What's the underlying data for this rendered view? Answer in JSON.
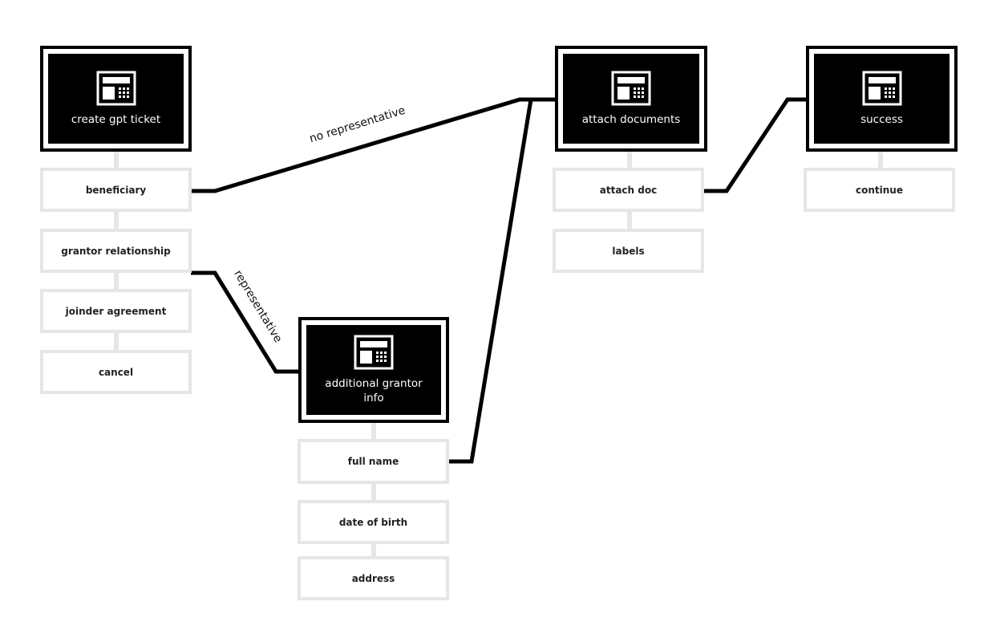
{
  "diagram": {
    "screens": [
      {
        "id": "create",
        "title": "create gpt ticket",
        "icon": "terminal-keypad-icon",
        "options": [
          "beneficiary",
          "grantor relationship",
          "joinder agreement",
          "cancel"
        ]
      },
      {
        "id": "grantor",
        "title": "additional grantor info",
        "icon": "terminal-keypad-icon",
        "options": [
          "full name",
          "date of birth",
          "address"
        ]
      },
      {
        "id": "attach",
        "title": "attach documents",
        "icon": "terminal-keypad-icon",
        "options": [
          "attach doc",
          "labels"
        ]
      },
      {
        "id": "success",
        "title": "success",
        "icon": "terminal-keypad-icon",
        "options": [
          "continue"
        ]
      }
    ],
    "edges": [
      {
        "from": "create.beneficiary",
        "to": "attach",
        "label": "no representative"
      },
      {
        "from": "create.grantor relationship",
        "to": "grantor",
        "label": "representative"
      },
      {
        "from": "grantor.full name",
        "to": "attach",
        "label": ""
      },
      {
        "from": "attach.attach doc",
        "to": "success",
        "label": ""
      }
    ],
    "colors": {
      "screen": "#000000",
      "option_border": "#e6e6e6",
      "wire": "#000000"
    }
  }
}
